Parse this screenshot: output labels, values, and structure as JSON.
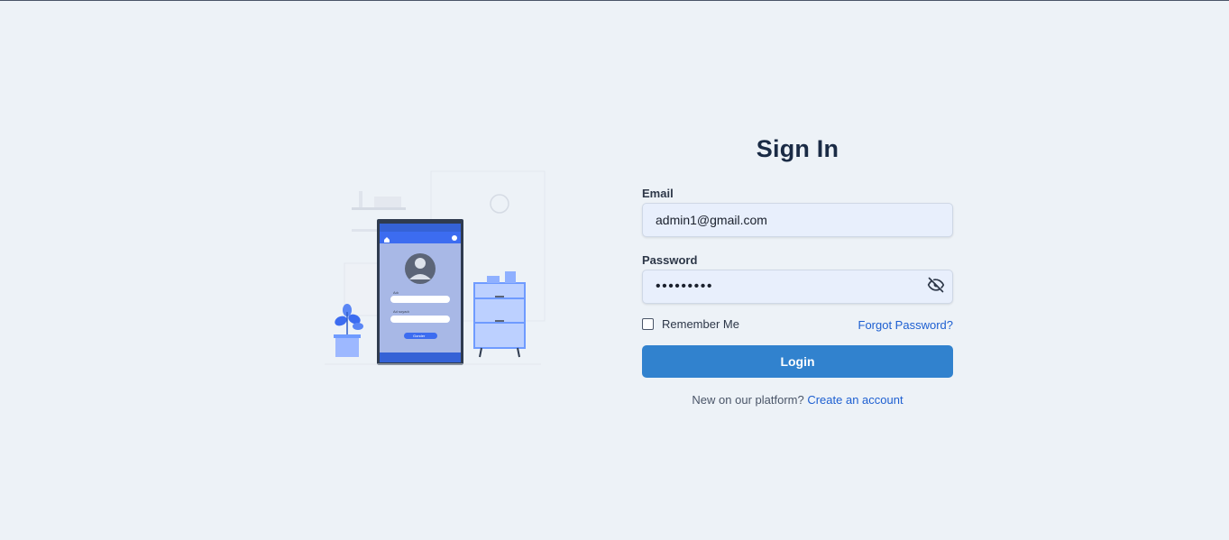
{
  "form": {
    "title": "Sign In",
    "email": {
      "label": "Email",
      "value": "admin1@gmail.com",
      "placeholder": ""
    },
    "password": {
      "label": "Password",
      "value": "•••••••••",
      "toggle_icon": "eye-off-icon"
    },
    "remember_label": "Remember Me",
    "forgot_label": "Forgot Password?",
    "login_label": "Login",
    "signup_prompt": "New on our platform?",
    "signup_link": "Create an account"
  },
  "illustration": {
    "phone_name_label": "Adı",
    "phone_surname_label": "Ad soyadı",
    "phone_button_label": "Gonder"
  },
  "colors": {
    "background": "#edf2f7",
    "primary": "#3182ce",
    "link": "#1d5fd1",
    "input_bg": "#e8effc"
  }
}
